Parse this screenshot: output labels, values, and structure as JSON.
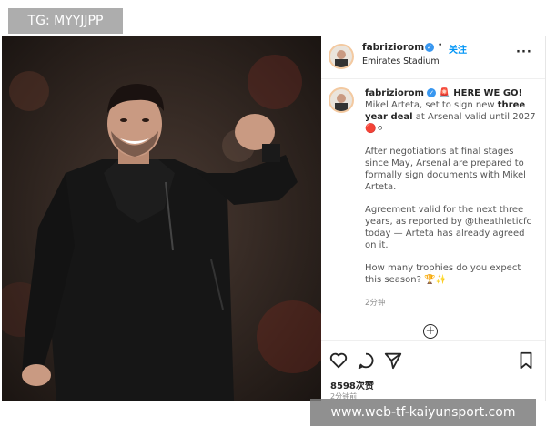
{
  "watermark_top": "TG: MYYJJPP",
  "watermark_bottom": "www.web-tf-kaiyunsport.com",
  "post": {
    "image_alt": "Mikel Arteta celebrating with raised fist",
    "header": {
      "username": "fabriziorom",
      "verified_glyph": "✓",
      "separator": "•",
      "follow_label": "关注",
      "location": "Emirates Stadium",
      "more_glyph": "···"
    },
    "caption": {
      "username": "fabriziorom",
      "verified_glyph": "✓",
      "p1_lead": "🚨 HERE WE GO!",
      "p1_a": "Mikel Arteta, set to sign new",
      "p1_bold": "three year deal",
      "p1_b": "at Arsenal valid until 2027",
      "p1_emoji": "🔴⚪",
      "p2": "After negotiations at final stages since May, Arsenal are prepared to formally sign documents with Mikel Arteta.",
      "p3": "Agreement valid for the next three years, as reported by @theathleticfc today — Arteta has already agreed on it.",
      "p4": "How many trophies do you expect this season? 🏆✨",
      "time_ago": "2分钟"
    },
    "load_more_glyph": "+",
    "icons": [
      "heart-icon",
      "comment-icon",
      "share-icon",
      "bookmark-icon"
    ],
    "likes": "8598次赞",
    "posted": "2分钟前"
  },
  "colors": {
    "accent": "#0095f6",
    "verified": "#3897f0",
    "photo_bg": "#1c1714",
    "watermark": "#8a8a8a"
  }
}
